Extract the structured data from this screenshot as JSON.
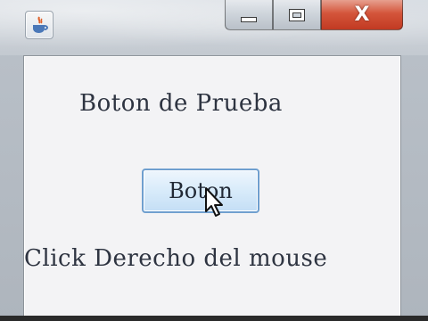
{
  "window": {
    "title": "",
    "app_icon": "java-icon",
    "controls": {
      "minimize_icon": "minimize-icon",
      "maximize_icon": "maximize-icon",
      "close_label": "X"
    },
    "close_color": "#d4553b"
  },
  "content": {
    "heading": "Boton de Prueba",
    "button_label": "Boton",
    "hint": "Click Derecho del mouse"
  },
  "cursor": "pointer-cursor"
}
